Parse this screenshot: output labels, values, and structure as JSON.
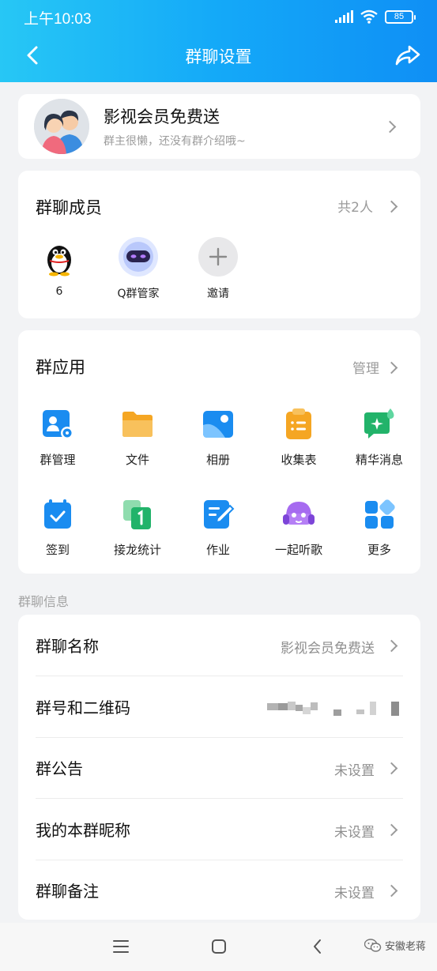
{
  "status_bar": {
    "time": "上午10:03",
    "battery": "85"
  },
  "nav": {
    "title": "群聊设置",
    "back_icon": "back-arrow-icon",
    "share_icon": "share-icon"
  },
  "group": {
    "name": "影视会员免费送",
    "description": "群主很懒，还没有群介绍哦~"
  },
  "members": {
    "title": "群聊成员",
    "count": "共2人",
    "items": [
      {
        "label": "6",
        "icon": "penguin-avatar"
      },
      {
        "label": "Q群管家",
        "icon": "robot-avatar"
      },
      {
        "label": "邀请",
        "icon": "plus-icon"
      }
    ]
  },
  "apps": {
    "title": "群应用",
    "manage": "管理",
    "items": [
      {
        "label": "群管理",
        "icon": "group-manage-icon"
      },
      {
        "label": "文件",
        "icon": "folder-icon"
      },
      {
        "label": "相册",
        "icon": "album-icon"
      },
      {
        "label": "收集表",
        "icon": "clipboard-icon"
      },
      {
        "label": "精华消息",
        "icon": "essence-message-icon"
      },
      {
        "label": "签到",
        "icon": "calendar-check-icon"
      },
      {
        "label": "接龙统计",
        "icon": "relay-icon"
      },
      {
        "label": "作业",
        "icon": "homework-icon"
      },
      {
        "label": "一起听歌",
        "icon": "music-icon"
      },
      {
        "label": "更多",
        "icon": "more-grid-icon"
      }
    ]
  },
  "info": {
    "section_label": "群聊信息",
    "rows": [
      {
        "label": "群聊名称",
        "value": "影视会员免费送"
      },
      {
        "label": "群号和二维码",
        "value": ""
      },
      {
        "label": "群公告",
        "value": "未设置"
      },
      {
        "label": "我的本群昵称",
        "value": "未设置"
      },
      {
        "label": "群聊备注",
        "value": "未设置"
      }
    ]
  },
  "watermark": "安徽老蒋",
  "colors": {
    "header_start": "#27c7f5",
    "header_end": "#0f8ff5",
    "accent_blue": "#1a8cf0",
    "orange": "#f5a623",
    "green": "#22b36a"
  }
}
